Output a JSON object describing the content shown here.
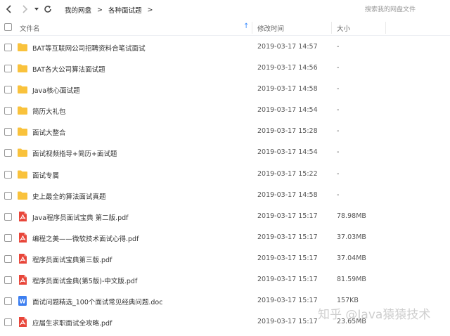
{
  "nav": {
    "back_icon": "chevron-left-icon",
    "forward_icon": "chevron-right-icon",
    "dropdown_icon": "caret-down-icon",
    "refresh_icon": "refresh-icon"
  },
  "breadcrumb": {
    "items": [
      "我的网盘",
      "各种面试题"
    ],
    "separator": ">",
    "trailing_separator": ">"
  },
  "search": {
    "placeholder": "搜索我的网盘文件"
  },
  "table_header": {
    "name": "文件名",
    "sort_indicator": "↑",
    "time": "修改时间",
    "size": "大小"
  },
  "files": [
    {
      "name": "BAT等互联网公司招聘资料合笔试面试",
      "time": "2019-03-17 14:57",
      "size": "-",
      "type": "folder"
    },
    {
      "name": "BAT各大公司算法面试题",
      "time": "2019-03-17 14:56",
      "size": "-",
      "type": "folder"
    },
    {
      "name": "Java核心面试题",
      "time": "2019-03-17 14:58",
      "size": "-",
      "type": "folder"
    },
    {
      "name": "简历大礼包",
      "time": "2019-03-17 14:54",
      "size": "-",
      "type": "folder"
    },
    {
      "name": "面试大整合",
      "time": "2019-03-17 15:28",
      "size": "-",
      "type": "folder"
    },
    {
      "name": "面试视频指导+简历+面试题",
      "time": "2019-03-17 14:54",
      "size": "-",
      "type": "folder"
    },
    {
      "name": "面试专属",
      "time": "2019-03-17 15:22",
      "size": "-",
      "type": "folder"
    },
    {
      "name": "史上最全的算法面试真题",
      "time": "2019-03-17 14:58",
      "size": "-",
      "type": "folder"
    },
    {
      "name": "Java程序员面试宝典 第二版.pdf",
      "time": "2019-03-17 15:17",
      "size": "78.98MB",
      "type": "pdf"
    },
    {
      "name": "编程之美——微软技术面试心得.pdf",
      "time": "2019-03-17 15:17",
      "size": "37.03MB",
      "type": "pdf"
    },
    {
      "name": "程序员面试宝典第三版.pdf",
      "time": "2019-03-17 15:17",
      "size": "37.04MB",
      "type": "pdf"
    },
    {
      "name": "程序员面试金典(第5版)-中文版.pdf",
      "time": "2019-03-17 15:17",
      "size": "81.59MB",
      "type": "pdf"
    },
    {
      "name": "面试问题精选_100个面试常见经典问题.doc",
      "time": "2019-03-17 15:17",
      "size": "157KB",
      "type": "doc"
    },
    {
      "name": "应届生求职面试全攻略.pdf",
      "time": "2019-03-17 15:17",
      "size": "23.65MB",
      "type": "pdf"
    }
  ],
  "colors": {
    "folder": "#f9c23c",
    "pdf": "#e8463a",
    "doc": "#3d7ff0",
    "accent": "#3b8cff"
  },
  "watermark": {
    "text": "知乎 @Java猿猿技术"
  }
}
